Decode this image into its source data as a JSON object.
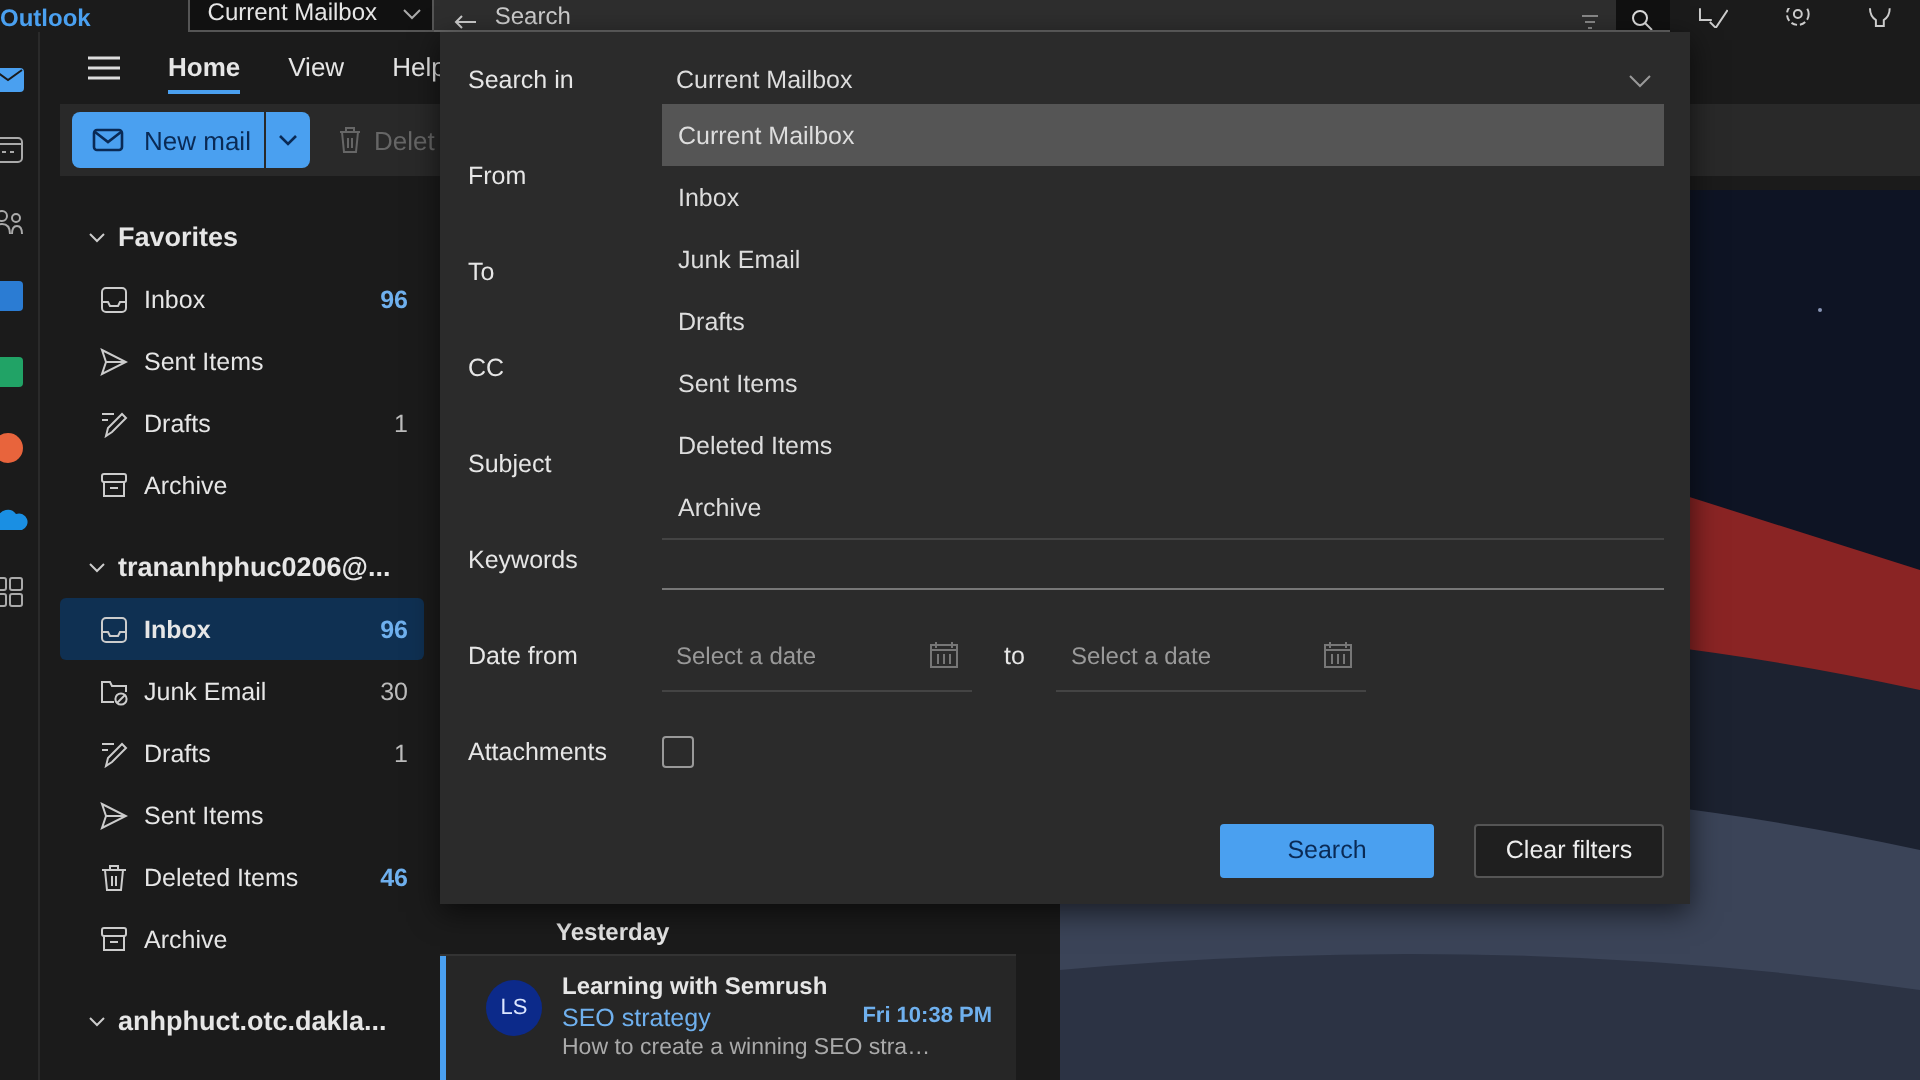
{
  "app": {
    "name": "Outlook"
  },
  "search_bar": {
    "scope": "Current Mailbox",
    "placeholder": "Search"
  },
  "rail": [
    {
      "kind": "mail",
      "selected": true
    },
    {
      "kind": "calendar",
      "selected": false
    },
    {
      "kind": "people",
      "selected": false
    },
    {
      "kind": "word",
      "selected": false
    },
    {
      "kind": "excel",
      "selected": false
    },
    {
      "kind": "powerpoint",
      "selected": false
    },
    {
      "kind": "onedrive",
      "selected": false
    },
    {
      "kind": "apps",
      "selected": false
    }
  ],
  "ribbon": {
    "tabs": [
      {
        "label": "Home",
        "selected": true
      },
      {
        "label": "View",
        "selected": false
      },
      {
        "label": "Help",
        "selected": false
      }
    ],
    "new_mail": "New mail",
    "delete": "Delet"
  },
  "folders": [
    {
      "title": "Favorites",
      "expanded": true,
      "children": [
        {
          "kind": "inbox",
          "label": "Inbox",
          "count": "96",
          "unread": true,
          "selected": false
        },
        {
          "kind": "sent",
          "label": "Sent Items",
          "selected": false
        },
        {
          "kind": "drafts",
          "label": "Drafts",
          "count": "1",
          "unread": false,
          "selected": false
        },
        {
          "kind": "archive",
          "label": "Archive",
          "selected": false
        }
      ]
    },
    {
      "title": "trananhphuc0206@...",
      "expanded": true,
      "children": [
        {
          "kind": "inbox",
          "label": "Inbox",
          "count": "96",
          "unread": true,
          "selected": true
        },
        {
          "kind": "junk",
          "label": "Junk Email",
          "count": "30",
          "unread": false,
          "selected": false
        },
        {
          "kind": "drafts",
          "label": "Drafts",
          "count": "1",
          "unread": false,
          "selected": false
        },
        {
          "kind": "sent",
          "label": "Sent Items",
          "selected": false
        },
        {
          "kind": "deleted",
          "label": "Deleted Items",
          "count": "46",
          "unread": true,
          "selected": false
        },
        {
          "kind": "archive",
          "label": "Archive",
          "selected": false
        }
      ]
    },
    {
      "title": "anhphuct.otc.dakla...",
      "expanded": true
    }
  ],
  "messages": {
    "group": "Yesterday",
    "items": [
      {
        "initials": "LS",
        "sender": "Learning with Semrush",
        "subject": "SEO strategy",
        "time": "Fri 10:38 PM",
        "preview": "How to create a winning SEO stra…",
        "selected": true
      }
    ]
  },
  "search_panel": {
    "fields": [
      {
        "kind": "select",
        "label": "Search in",
        "value": "Current Mailbox"
      },
      {
        "kind": "covered",
        "label": "From"
      },
      {
        "kind": "covered",
        "label": "To"
      },
      {
        "kind": "covered",
        "label": "CC"
      },
      {
        "kind": "covered",
        "label": "Subject"
      },
      {
        "kind": "text",
        "label": "Keywords"
      },
      {
        "kind": "date_range",
        "label": "Date from",
        "from_placeholder": "Select a date",
        "separator": "to",
        "to_placeholder": "Select a date"
      },
      {
        "kind": "checkbox",
        "label": "Attachments",
        "checked": false
      }
    ],
    "dropdown": {
      "open": true,
      "options": [
        {
          "label": "Current Mailbox",
          "selected": true
        },
        {
          "label": "Inbox",
          "selected": false
        },
        {
          "label": "Junk Email",
          "selected": false
        },
        {
          "label": "Drafts",
          "selected": false
        },
        {
          "label": "Sent Items",
          "selected": false
        },
        {
          "label": "Deleted Items",
          "selected": false
        },
        {
          "label": "Archive",
          "selected": false
        }
      ]
    },
    "buttons": [
      {
        "label": "Search",
        "primary": true
      },
      {
        "label": "Clear filters",
        "primary": false
      }
    ]
  }
}
